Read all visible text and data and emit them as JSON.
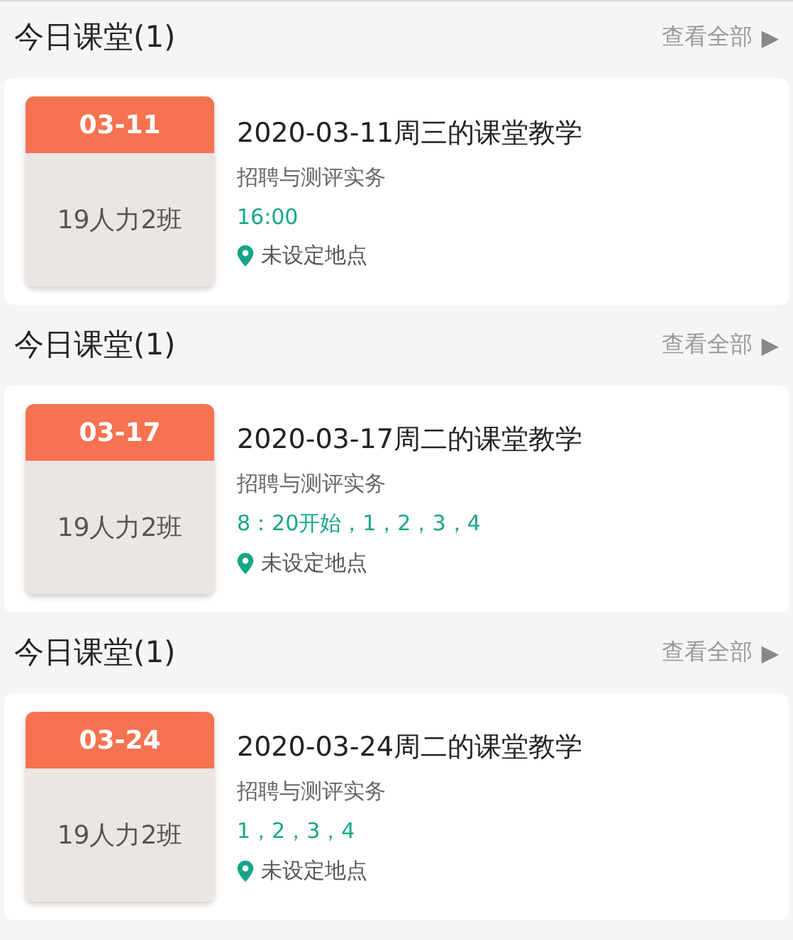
{
  "sections": [
    {
      "title": "今日课堂(1)",
      "link": "查看全部",
      "arrow": "▶",
      "card": {
        "date": "03-11",
        "class_name": "19人力2班",
        "title": "2020-03-11周三的课堂教学",
        "course": "招聘与测评实务",
        "schedule": "16:00",
        "location": "未设定地点"
      }
    },
    {
      "title": "今日课堂(1)",
      "link": "查看全部",
      "arrow": "▶",
      "card": {
        "date": "03-17",
        "class_name": "19人力2班",
        "title": "2020-03-17周二的课堂教学",
        "course": "招聘与测评实务",
        "schedule": "8：20开始，1，2，3，4",
        "location": "未设定地点"
      }
    },
    {
      "title": "今日课堂(1)",
      "link": "查看全部",
      "arrow": "▶",
      "card": {
        "date": "03-24",
        "class_name": "19人力2班",
        "title": "2020-03-24周二的课堂教学",
        "course": "招聘与测评实务",
        "schedule": "1，2，3，4",
        "location": "未设定地点"
      }
    }
  ]
}
